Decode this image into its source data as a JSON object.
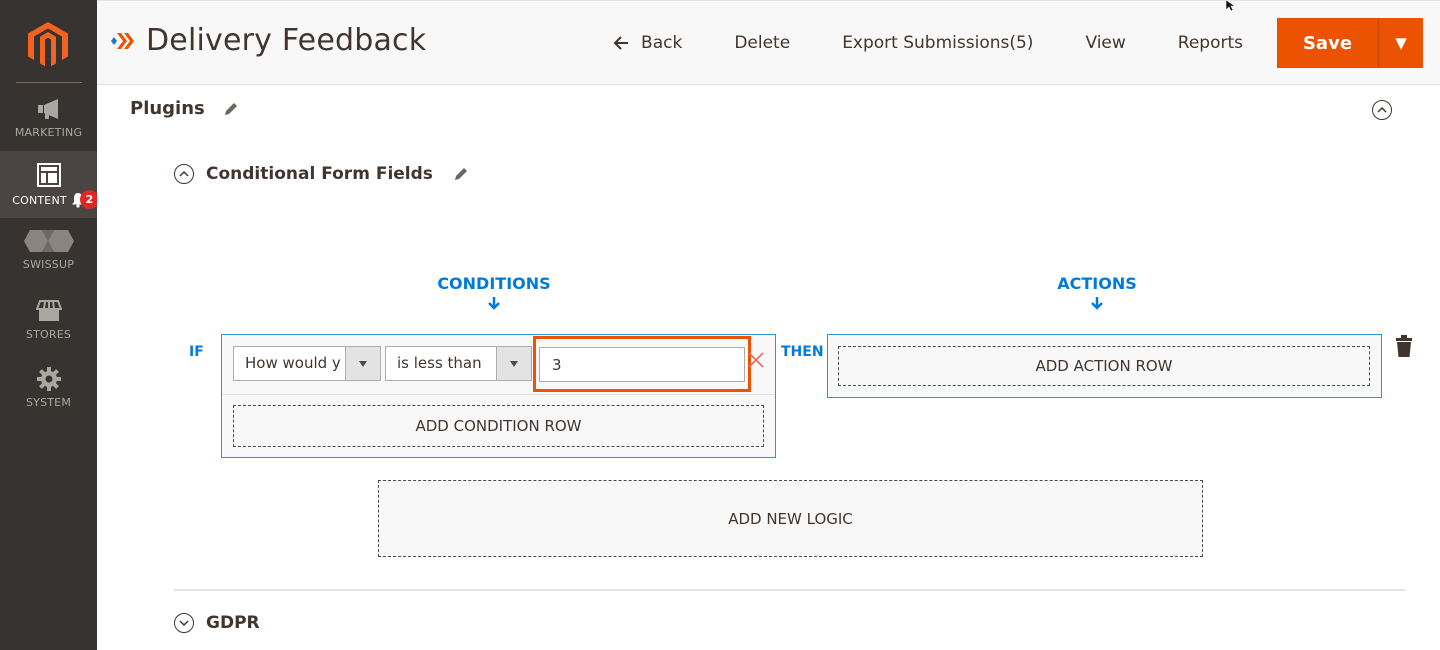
{
  "sidebar": {
    "items": [
      {
        "label": "MARKETING",
        "icon": "megaphone-icon"
      },
      {
        "label": "CONTENT",
        "icon": "layout-icon",
        "active": true
      },
      {
        "label": "SWISSUP",
        "icon": "swissup-icon"
      },
      {
        "label": "STORES",
        "icon": "store-icon"
      },
      {
        "label": "SYSTEM",
        "icon": "gear-icon"
      }
    ],
    "notification_count": "2"
  },
  "header": {
    "title": "Delivery Feedback",
    "actions": {
      "back": "Back",
      "delete": "Delete",
      "export": "Export Submissions(5)",
      "view": "View",
      "reports": "Reports",
      "save": "Save"
    }
  },
  "main": {
    "section_title": "Plugins",
    "subsection_title": "Conditional Form Fields",
    "conditions_label": "CONDITIONS",
    "actions_label": "ACTIONS",
    "if_label": "IF",
    "then_label": "THEN",
    "condition": {
      "field": "How would y",
      "operator": "is less than",
      "value": "3"
    },
    "add_condition_row": "ADD CONDITION ROW",
    "add_action_row": "ADD ACTION ROW",
    "add_new_logic": "ADD NEW LOGIC",
    "gdpr_title": "GDPR"
  },
  "colors": {
    "accent": "#eb5202",
    "link_blue": "#007bdb",
    "sidebar_bg": "#373330"
  }
}
